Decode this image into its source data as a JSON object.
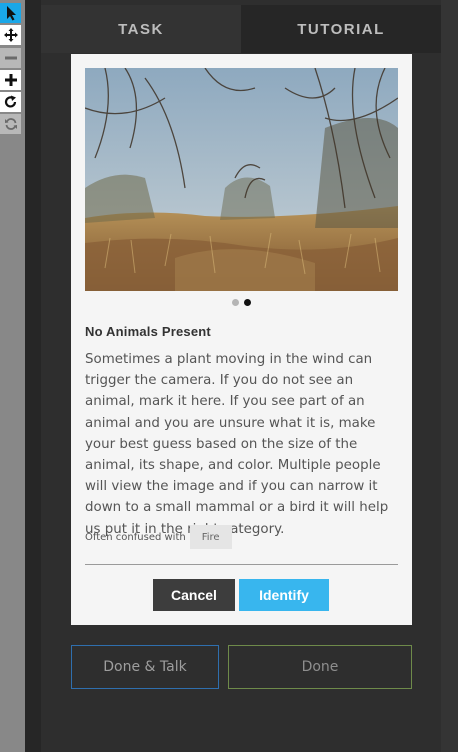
{
  "toolbar": {
    "tools": [
      {
        "icon": "pointer-icon",
        "state": "active"
      },
      {
        "icon": "move-icon",
        "state": "normal"
      },
      {
        "icon": "zoom-out-icon",
        "state": "disabled"
      },
      {
        "icon": "zoom-in-icon",
        "state": "normal"
      },
      {
        "icon": "rotate-icon",
        "state": "normal"
      },
      {
        "icon": "reset-icon",
        "state": "disabled"
      }
    ]
  },
  "tabs": {
    "task_label": "TASK",
    "tutorial_label": "TUTORIAL",
    "selected": "TASK"
  },
  "card": {
    "image_alt": "",
    "carousel": {
      "count": 2,
      "active_index": 1
    },
    "title": "No Animals Present",
    "description": "Sometimes a plant moving in the wind can trigger the camera. If you do not see an animal, mark it here. If you see part of an animal and you are unsure what it is, make your best guess based on the size of the animal, its shape, and color. Multiple people will view the image and if you can narrow it down to a small mammal or a bird it will help us put it in the right category.",
    "confused_label": "Often confused with",
    "confused_items": [
      "Fire"
    ],
    "cancel_label": "Cancel",
    "identify_label": "Identify"
  },
  "footer": {
    "done_talk_label": "Done & Talk",
    "done_label": "Done"
  },
  "colors": {
    "accent": "#38b6ee",
    "active_tool": "#1aa7e8",
    "panel_bg": "#2e2e2e",
    "card_bg": "#f5f5f5",
    "done_talk_border": "#2f6fae",
    "done_border": "#6e8a4a"
  }
}
